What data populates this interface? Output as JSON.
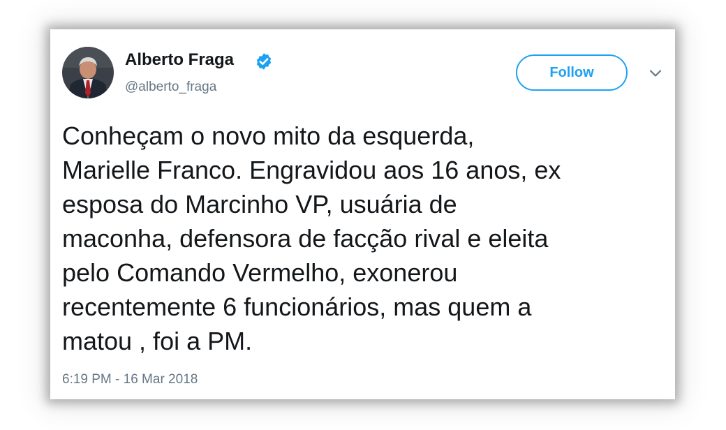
{
  "tweet": {
    "author": {
      "name": "Alberto Fraga",
      "handle": "@alberto_fraga",
      "verified": true,
      "avatar_icon": "profile-photo"
    },
    "follow_label": "Follow",
    "menu_icon": "chevron-down-icon",
    "lines": [
      "Conheçam o novo mito da esquerda,",
      "Marielle Franco. Engravidou aos 16 anos, ex",
      "esposa do Marcinho VP, usuária de",
      "maconha, defensora de facção rival e eleita",
      "pelo Comando Vermelho, exonerou",
      "recentemente 6 funcionários, mas quem a",
      "matou , foi a PM."
    ],
    "timestamp": "6:19 PM - 16 Mar 2018"
  },
  "colors": {
    "accent": "#1da1f2",
    "text_primary": "#14171a",
    "text_secondary": "#657786"
  }
}
